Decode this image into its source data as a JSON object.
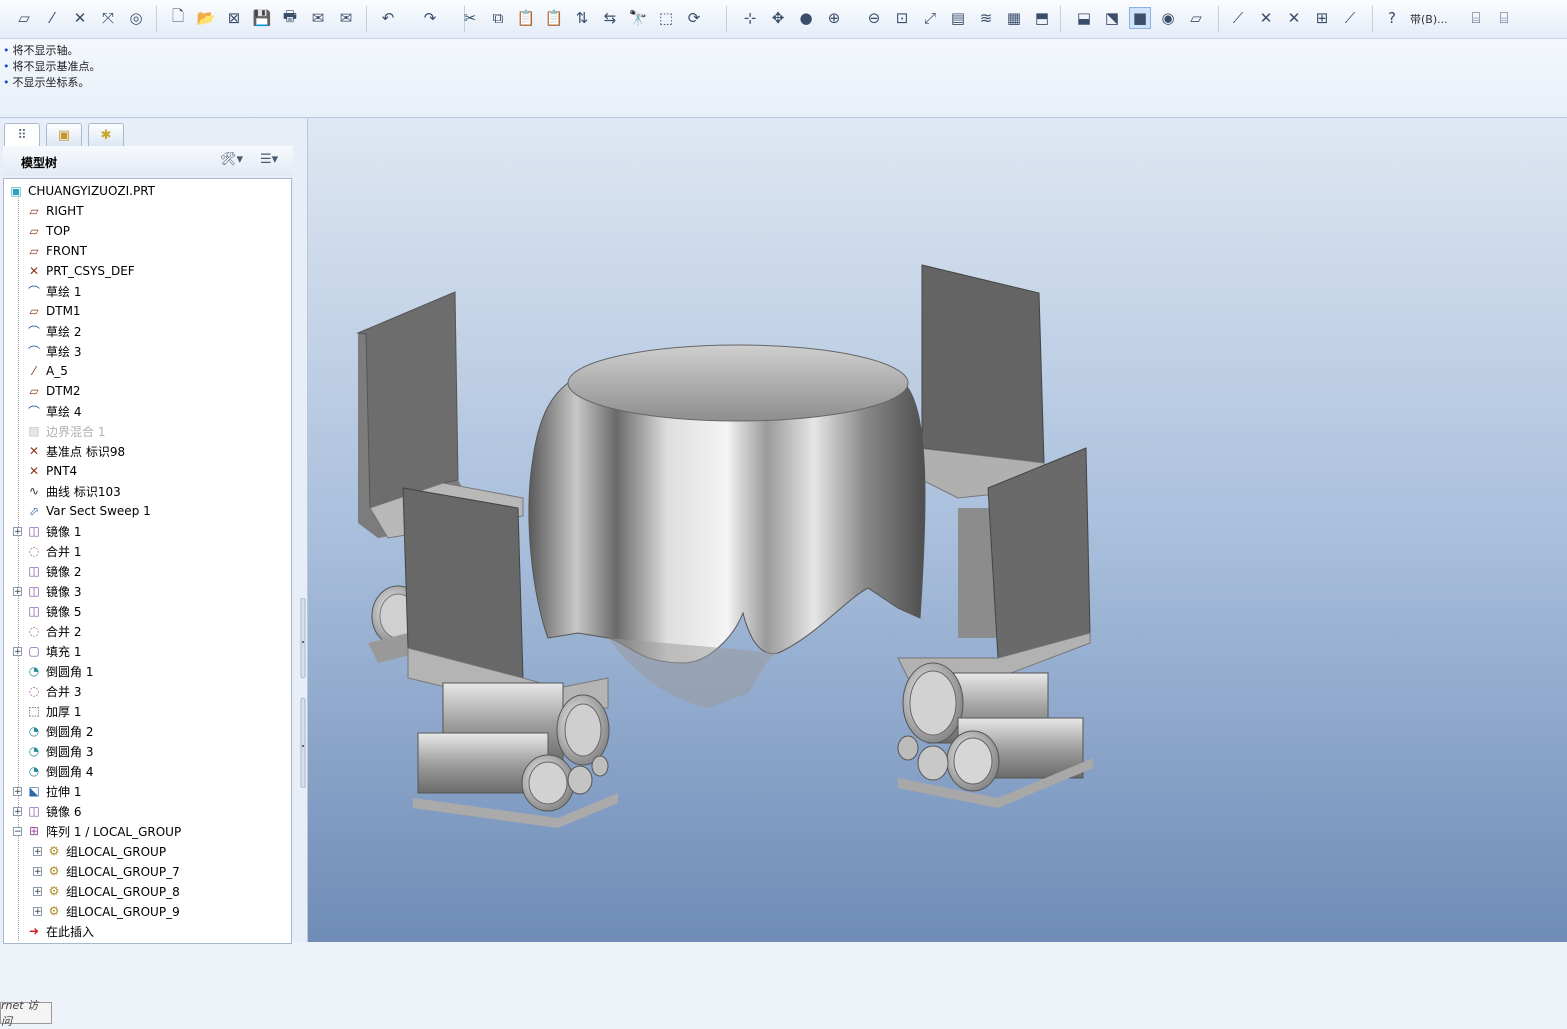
{
  "messages": [
    "将不显示轴。",
    "将不显示基准点。",
    "不显示坐标系。"
  ],
  "toolbar": {
    "display_style_label": "带(B)...",
    "icons": [
      "datum-plane-display-icon",
      "datum-axis-display-icon",
      "point-display-icon",
      "csys-display-icon",
      "spin-center-icon",
      "new-file-icon",
      "open-file-icon",
      "close-window-icon",
      "save-icon",
      "print-icon",
      "email-icon",
      "email-link-icon",
      "undo-icon",
      "redo-icon",
      "cut-icon",
      "copy-icon",
      "paste-icon",
      "paste-special-icon",
      "regenerate-icon",
      "regen-manager-icon",
      "find-icon",
      "select-box-icon",
      "repaint-icon",
      "orient-icon",
      "spin-icon",
      "render-sphere-icon",
      "zoom-in-icon",
      "zoom-out-icon",
      "refit-icon",
      "view-orient-icon",
      "saved-views-icon",
      "layers-icon",
      "view-manager-icon",
      "wireframe-icon",
      "hidden-line-icon",
      "no-hidden-icon",
      "shading-icon",
      "enhanced-realism-icon",
      "plane-tool-icon",
      "axis-tool-icon",
      "point-tool-icon",
      "csys-tool-icon",
      "annotation-icon",
      "sketch-curve-icon",
      "whats-this-icon",
      "measure-icon",
      "analysis-icon"
    ]
  },
  "navigator": {
    "title": "模型树",
    "tabs": [
      "model-tree-tab",
      "folder-browser-tab",
      "favorites-tab"
    ]
  },
  "tree": [
    {
      "label": "CHUANGYIZUOZI.PRT",
      "icon": "part-icon",
      "level": 0,
      "expander": "",
      "dim": false
    },
    {
      "label": "RIGHT",
      "icon": "datum-plane-icon",
      "level": 1,
      "expander": "",
      "dim": false
    },
    {
      "label": "TOP",
      "icon": "datum-plane-icon",
      "level": 1,
      "expander": "",
      "dim": false
    },
    {
      "label": "FRONT",
      "icon": "datum-plane-icon",
      "level": 1,
      "expander": "",
      "dim": false
    },
    {
      "label": "PRT_CSYS_DEF",
      "icon": "csys-icon",
      "level": 1,
      "expander": "",
      "dim": false
    },
    {
      "label": "草绘 1",
      "icon": "sketch-icon",
      "level": 1,
      "expander": "",
      "dim": false
    },
    {
      "label": "DTM1",
      "icon": "datum-plane-icon",
      "level": 1,
      "expander": "",
      "dim": false
    },
    {
      "label": "草绘 2",
      "icon": "sketch-icon",
      "level": 1,
      "expander": "",
      "dim": false
    },
    {
      "label": "草绘 3",
      "icon": "sketch-icon",
      "level": 1,
      "expander": "",
      "dim": false
    },
    {
      "label": "A_5",
      "icon": "datum-axis-icon",
      "level": 1,
      "expander": "",
      "dim": false
    },
    {
      "label": "DTM2",
      "icon": "datum-plane-icon",
      "level": 1,
      "expander": "",
      "dim": false
    },
    {
      "label": "草绘 4",
      "icon": "sketch-icon",
      "level": 1,
      "expander": "",
      "dim": false
    },
    {
      "label": "边界混合 1",
      "icon": "boundary-blend-icon",
      "level": 1,
      "expander": "",
      "dim": true
    },
    {
      "label": "基准点 标识98",
      "icon": "datum-point-icon",
      "level": 1,
      "expander": "",
      "dim": false
    },
    {
      "label": "PNT4",
      "icon": "datum-point-icon",
      "level": 1,
      "expander": "",
      "dim": false
    },
    {
      "label": "曲线 标识103",
      "icon": "curve-icon",
      "level": 1,
      "expander": "",
      "dim": false
    },
    {
      "label": "Var Sect Sweep 1",
      "icon": "sweep-icon",
      "level": 1,
      "expander": "",
      "dim": false
    },
    {
      "label": "镜像 1",
      "icon": "mirror-icon",
      "level": 1,
      "expander": "+",
      "dim": false
    },
    {
      "label": "合并 1",
      "icon": "merge-icon",
      "level": 1,
      "expander": "",
      "dim": false
    },
    {
      "label": "镜像 2",
      "icon": "mirror-icon",
      "level": 1,
      "expander": "",
      "dim": false
    },
    {
      "label": "镜像 3",
      "icon": "mirror-icon",
      "level": 1,
      "expander": "+",
      "dim": false
    },
    {
      "label": "镜像 5",
      "icon": "mirror-icon",
      "level": 1,
      "expander": "",
      "dim": false
    },
    {
      "label": "合并 2",
      "icon": "merge-icon",
      "level": 1,
      "expander": "",
      "dim": false
    },
    {
      "label": "填充 1",
      "icon": "fill-icon",
      "level": 1,
      "expander": "+",
      "dim": false
    },
    {
      "label": "倒圆角 1",
      "icon": "round-icon",
      "level": 1,
      "expander": "",
      "dim": false
    },
    {
      "label": "合并 3",
      "icon": "merge-icon",
      "level": 1,
      "expander": "",
      "dim": false
    },
    {
      "label": "加厚 1",
      "icon": "thicken-icon",
      "level": 1,
      "expander": "",
      "dim": false
    },
    {
      "label": "倒圆角 2",
      "icon": "round-icon",
      "level": 1,
      "expander": "",
      "dim": false
    },
    {
      "label": "倒圆角 3",
      "icon": "round-icon",
      "level": 1,
      "expander": "",
      "dim": false
    },
    {
      "label": "倒圆角 4",
      "icon": "round-icon",
      "level": 1,
      "expander": "",
      "dim": false
    },
    {
      "label": "拉伸 1",
      "icon": "extrude-icon",
      "level": 1,
      "expander": "+",
      "dim": false
    },
    {
      "label": "镜像 6",
      "icon": "mirror-icon",
      "level": 1,
      "expander": "+",
      "dim": false
    },
    {
      "label": "阵列 1 / LOCAL_GROUP",
      "icon": "pattern-icon",
      "level": 1,
      "expander": "−",
      "dim": false
    },
    {
      "label": "组LOCAL_GROUP",
      "icon": "group-icon",
      "level": 2,
      "expander": "+",
      "dim": false
    },
    {
      "label": "组LOCAL_GROUP_7",
      "icon": "group-icon",
      "level": 2,
      "expander": "+",
      "dim": false
    },
    {
      "label": "组LOCAL_GROUP_8",
      "icon": "group-icon",
      "level": 2,
      "expander": "+",
      "dim": false
    },
    {
      "label": "组LOCAL_GROUP_9",
      "icon": "group-icon",
      "level": 2,
      "expander": "+",
      "dim": false
    },
    {
      "label": "在此插入",
      "icon": "insert-arrow-icon",
      "level": 1,
      "expander": "",
      "dim": false
    }
  ],
  "tooltip": "rnet 访问",
  "colors": {
    "accent": "#1c4fc2",
    "datum": "#8b3a1a",
    "sketch": "#2a5aa8",
    "feature": "#7a4fa0"
  }
}
